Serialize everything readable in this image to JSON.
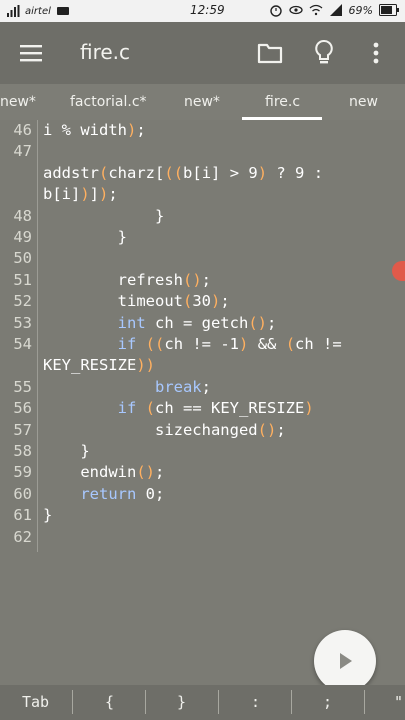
{
  "status_bar": {
    "carrier": "airtel",
    "time": "12:59",
    "battery": "69%"
  },
  "app_bar": {
    "title": "fire.c"
  },
  "tabs": [
    {
      "label": "new*"
    },
    {
      "label": "factorial.c*"
    },
    {
      "label": "new*"
    },
    {
      "label": "fire.c",
      "active": true
    },
    {
      "label": "new"
    }
  ],
  "editor": {
    "lines": [
      {
        "n": "46",
        "code": "i % width);"
      },
      {
        "n": "47",
        "code": ""
      },
      {
        "n": "",
        "code": "addstr(charz[((b[i] > 9) ? 9 :"
      },
      {
        "n": "",
        "code": "b[i])]);"
      },
      {
        "n": "48",
        "code": "            }"
      },
      {
        "n": "49",
        "code": "        }"
      },
      {
        "n": "50",
        "code": ""
      },
      {
        "n": "51",
        "code": "        refresh();"
      },
      {
        "n": "52",
        "code": "        timeout(30);"
      },
      {
        "n": "53",
        "code": "        int ch = getch();"
      },
      {
        "n": "54",
        "code": "        if ((ch != -1) && (ch !="
      },
      {
        "n": "",
        "code": "KEY_RESIZE))"
      },
      {
        "n": "55",
        "code": "            break;"
      },
      {
        "n": "56",
        "code": "        if (ch == KEY_RESIZE)"
      },
      {
        "n": "57",
        "code": "            sizechanged();"
      },
      {
        "n": "58",
        "code": "    }"
      },
      {
        "n": "59",
        "code": "    endwin();"
      },
      {
        "n": "60",
        "code": "    return 0;"
      },
      {
        "n": "61",
        "code": "}"
      },
      {
        "n": "62",
        "code": ""
      }
    ]
  },
  "key_bar": {
    "keys": [
      "Tab",
      "{",
      "}",
      ":",
      ";",
      "\""
    ]
  },
  "colors": {
    "keyword": "#a8c8ff",
    "paren": "#ffb060",
    "background": "#7b7b74"
  }
}
